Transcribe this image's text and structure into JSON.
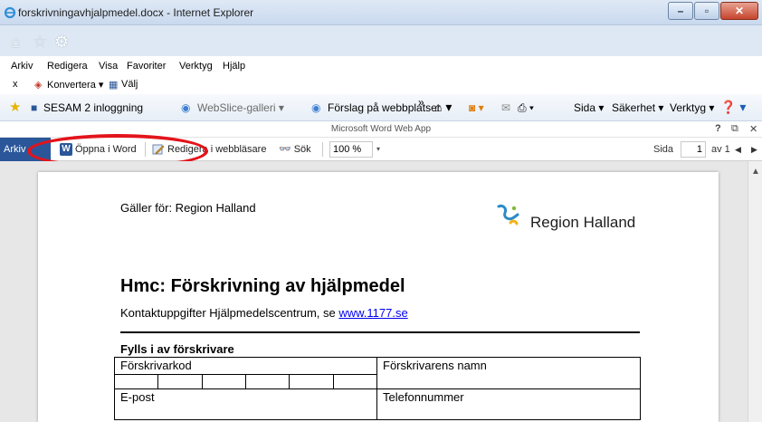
{
  "window": {
    "title": "forskrivningavhjalpmedel.docx - Internet Explorer",
    "buttons": [
      "–",
      "▫",
      "✕"
    ]
  },
  "nav_icons": [
    "home-icon",
    "star-icon",
    "gear-icon"
  ],
  "menubar": {
    "items": [
      "Arkiv",
      "Redigera",
      "Visa",
      "Favoriter",
      "Verktyg",
      "Hjälp"
    ]
  },
  "convert_bar": {
    "close": "x",
    "convert": "Konvertera ▾",
    "select": "Välj"
  },
  "favorites_bar": {
    "items": [
      "SESAM 2 inloggning",
      "WebSlice-galleri ▾",
      "Förslag på webbplatser"
    ],
    "overflow": "»",
    "commands": [
      "Sida ▾",
      "Säkerhet ▾",
      "Verktyg ▾"
    ]
  },
  "word_app": {
    "app_title": "Microsoft Word Web App",
    "help": "?",
    "close": "✕",
    "file_tab": "Arkiv",
    "open_in_word": "Öppna i Word",
    "edit_in_browser": "Redigera i webbläsare",
    "search": "Sök",
    "zoom": "100 %",
    "zoom_drop": "▾",
    "page_label": "Sida",
    "page_number": "1",
    "page_of": "av 1",
    "prev": "◀",
    "next": "▶"
  },
  "annotation_color": "#e3141b",
  "document": {
    "applies_to": "Gäller för: Region Halland",
    "logo_text": "Region Halland",
    "title": "Hmc: Förskrivning av hjälpmedel",
    "contact_prefix": "Kontaktuppgifter Hjälpmedelscentrum, se ",
    "contact_link": "www.1177.se",
    "section": "Fylls i av förskrivare",
    "table": {
      "r1c1": "Förskrivarkod",
      "r1c2": "Förskrivarens namn",
      "r2c1": "E-post",
      "r2c2": "Telefonnummer"
    }
  }
}
